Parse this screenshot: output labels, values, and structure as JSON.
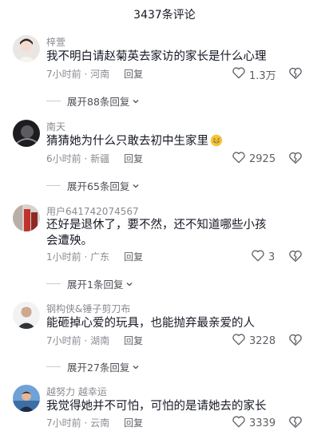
{
  "header": {
    "title": "3437条评论"
  },
  "comments": [
    {
      "username": "梓萱",
      "text": "我不明白请赵菊英去家访的家长是什么心理",
      "time_location": "7小时前 · 河南",
      "reply_label": "回复",
      "likes": "1.3万",
      "expand_label": "展开88条回复"
    },
    {
      "username": "南天",
      "text": "猜猜她为什么只敢去初中生家里",
      "emoji": "grinning-sweat-emoji",
      "time_location": "6小时前 · 新疆",
      "reply_label": "回复",
      "likes": "2925",
      "expand_label": "展开65条回复"
    },
    {
      "username": "用户641742074567",
      "text": "还好是退休了，要不然，还不知道哪些小孩会遭殃。",
      "time_location": "1小时前 · 广东",
      "reply_label": "回复",
      "likes": "3",
      "expand_label": "展开1条回复"
    },
    {
      "username": "钢构侠&锤子剪刀布",
      "text": "能砸掉心爱的玩具，也能抛弃最亲爱的人",
      "time_location": "7小时前 · 湖南",
      "reply_label": "回复",
      "likes": "3228",
      "expand_label": "展开27条回复"
    },
    {
      "username": "越努力 越幸运",
      "text": "我觉得她并不可怕，可怕的是请她去的家长",
      "time_location": "7小时前 · 云南",
      "reply_label": "回复",
      "likes": "3339"
    }
  ],
  "icons": {
    "like": "heart-outline-icon",
    "dislike": "broken-heart-icon",
    "expand": "chevron-down-icon"
  },
  "colors": {
    "text": "#161823",
    "secondary": "#8a8b91",
    "emoji": "#f7c531"
  }
}
